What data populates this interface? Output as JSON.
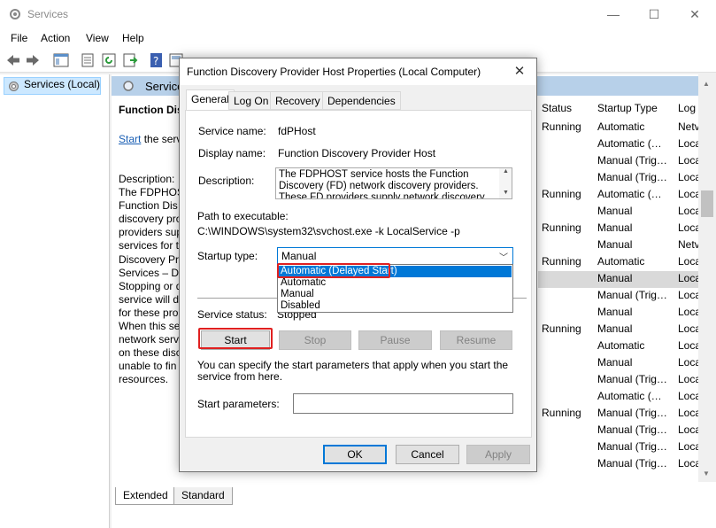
{
  "window": {
    "title": "Services",
    "controls": [
      "—",
      "☐",
      "✕"
    ]
  },
  "menu": [
    "File",
    "Action",
    "View",
    "Help"
  ],
  "left_pane": {
    "tree_item": "Services (Local)"
  },
  "right_pane": {
    "header": "Services",
    "service_name_heading": "Function Dis",
    "start_link": "Start",
    "start_suffix": "the serv",
    "description_label": "Description:",
    "description_lines": [
      "The FDPHOS",
      "Function Dis",
      "discovery pro",
      "providers sup",
      "services for t",
      "Discovery Pro",
      "Services – Dis",
      "Stopping or d",
      "service will d",
      "for these pro",
      "When this se",
      "network serv",
      "on these disc",
      "unable to fin",
      "resources."
    ],
    "columns": {
      "status": "Status",
      "startup": "Startup Type",
      "logon": "Log"
    },
    "rows": [
      {
        "status": "Running",
        "startup": "Automatic",
        "logon": "Netv"
      },
      {
        "status": "",
        "startup": "Automatic (…",
        "logon": "Loca"
      },
      {
        "status": "",
        "startup": "Manual (Trig…",
        "logon": "Loca"
      },
      {
        "status": "",
        "startup": "Manual (Trig…",
        "logon": "Loca"
      },
      {
        "status": "Running",
        "startup": "Automatic (…",
        "logon": "Loca"
      },
      {
        "status": "",
        "startup": "Manual",
        "logon": "Loca"
      },
      {
        "status": "Running",
        "startup": "Manual",
        "logon": "Loca"
      },
      {
        "status": "",
        "startup": "Manual",
        "logon": "Netv"
      },
      {
        "status": "Running",
        "startup": "Automatic",
        "logon": "Loca"
      },
      {
        "status": "",
        "startup": "Manual",
        "logon": "Loca"
      },
      {
        "status": "",
        "startup": "Manual (Trig…",
        "logon": "Loca"
      },
      {
        "status": "",
        "startup": "Manual",
        "logon": "Loca"
      },
      {
        "status": "Running",
        "startup": "Manual",
        "logon": "Loca"
      },
      {
        "status": "",
        "startup": "Automatic",
        "logon": "Loca"
      },
      {
        "status": "",
        "startup": "Manual",
        "logon": "Loca"
      },
      {
        "status": "",
        "startup": "Manual (Trig…",
        "logon": "Loca"
      },
      {
        "status": "",
        "startup": "Automatic (…",
        "logon": "Loca"
      },
      {
        "status": "Running",
        "startup": "Manual (Trig…",
        "logon": "Loca"
      },
      {
        "status": "",
        "startup": "Manual (Trig…",
        "logon": "Loca"
      },
      {
        "status": "",
        "startup": "Manual (Trig…",
        "logon": "Loca"
      },
      {
        "status": "",
        "startup": "Manual (Trig…",
        "logon": "Loca"
      }
    ],
    "tabs": [
      "Extended",
      "Standard"
    ]
  },
  "dialog": {
    "title": "Function Discovery Provider Host Properties (Local Computer)",
    "close": "✕",
    "tabs": [
      "General",
      "Log On",
      "Recovery",
      "Dependencies"
    ],
    "service_name_label": "Service name:",
    "service_name": "fdPHost",
    "display_name_label": "Display name:",
    "display_name": "Function Discovery Provider Host",
    "description_label": "Description:",
    "description": "The FDPHOST service hosts the Function Discovery (FD) network discovery providers. These FD providers supply network discovery services for",
    "path_label": "Path to executable:",
    "path": "C:\\WINDOWS\\system32\\svchost.exe -k LocalService -p",
    "startup_type_label": "Startup type:",
    "startup_type_value": "Manual",
    "startup_options": [
      "Automatic (Delayed Start)",
      "Automatic",
      "Manual",
      "Disabled"
    ],
    "service_status_label": "Service status:",
    "service_status": "Stopped",
    "buttons": {
      "start": "Start",
      "stop": "Stop",
      "pause": "Pause",
      "resume": "Resume"
    },
    "hint": "You can specify the start parameters that apply when you start the service from here.",
    "start_params_label": "Start parameters:",
    "start_params_value": "",
    "ok": "OK",
    "cancel": "Cancel",
    "apply": "Apply"
  },
  "colors": {
    "highlight_red": "#e02020",
    "select_blue": "#0078d7",
    "header_blue": "#b7d0e9"
  }
}
